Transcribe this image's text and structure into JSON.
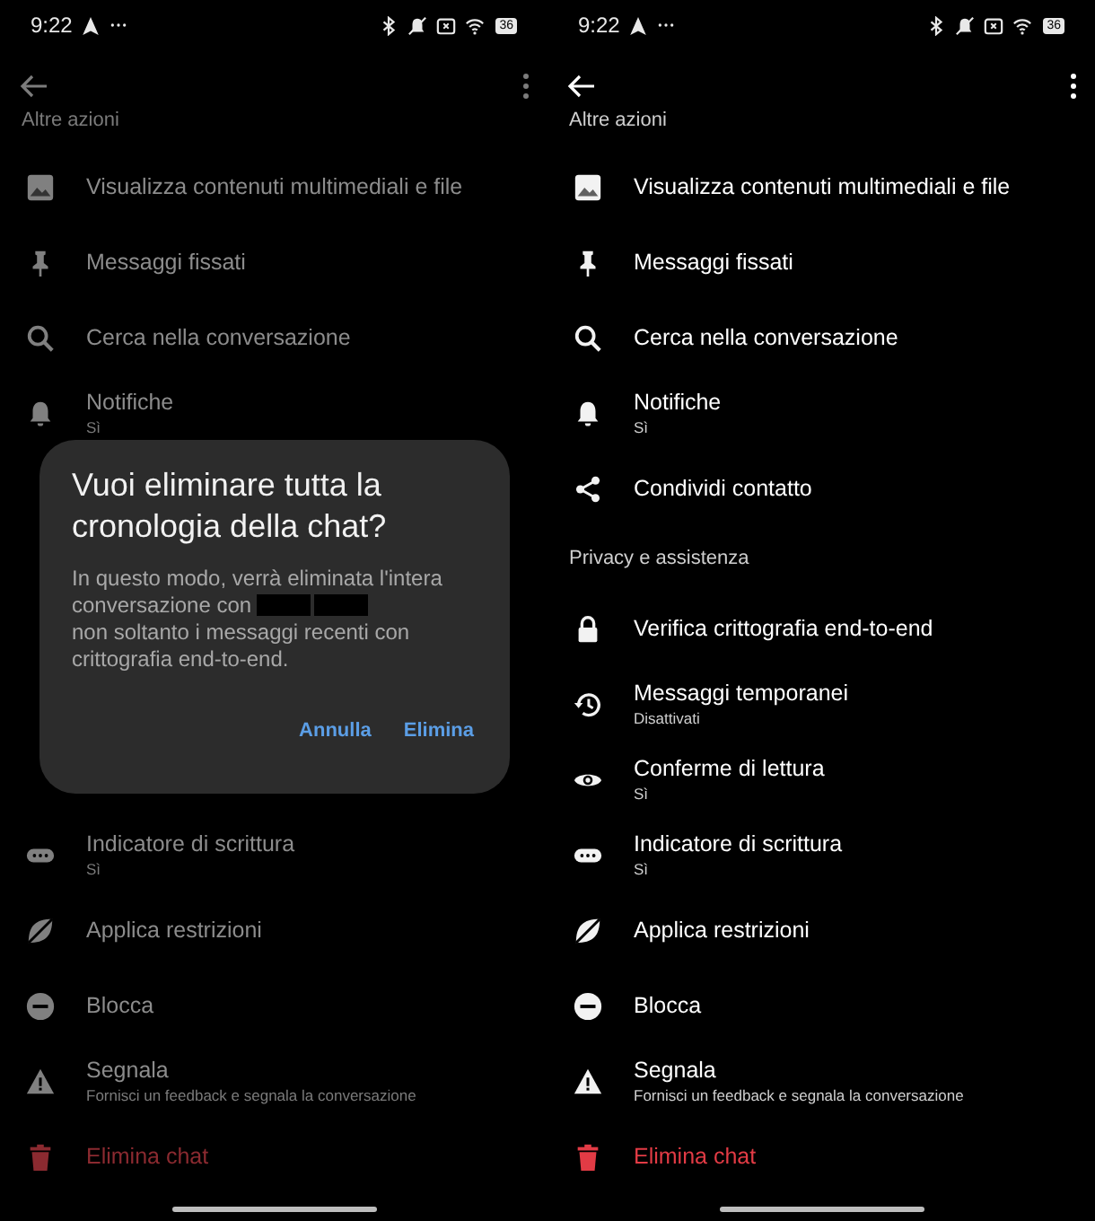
{
  "screens": [
    {
      "dimmed": true,
      "status_bar": {
        "time": "9:22",
        "battery": "36"
      },
      "rows": [
        {
          "kind": "header",
          "label": "Altre azioni"
        },
        {
          "kind": "media",
          "label": "Visualizza contenuti multimediali e file",
          "danger": false
        },
        {
          "kind": "pin",
          "label": "Messaggi fissati",
          "danger": false
        },
        {
          "kind": "search",
          "label": "Cerca nella conversazione",
          "danger": false
        },
        {
          "kind": "notifications",
          "label": "Notifiche",
          "sublabel": "Sì",
          "danger": false
        },
        {
          "kind": "dialog",
          "title": "Vuoi eliminare tutta la cronologia della chat?",
          "message_start": "In questo modo, verrà eliminata l'intera conversazione con",
          "message_end": "non soltanto i messaggi recenti con crittografia end-to-end.",
          "buttons": [
            "Annulla",
            "Elimina"
          ]
        },
        {
          "kind": "typing",
          "label": "Indicatore di scrittura",
          "sublabel": "Sì",
          "danger": false
        },
        {
          "kind": "restrict",
          "label": "Applica restrizioni",
          "danger": false
        },
        {
          "kind": "block",
          "label": "Blocca",
          "danger": false
        },
        {
          "kind": "report",
          "label": "Segnala",
          "sublabel": "Fornisci un feedback e segnala la conversazione",
          "danger": false
        },
        {
          "kind": "delete",
          "label": "Elimina chat",
          "danger": true
        }
      ]
    },
    {
      "dimmed": false,
      "status_bar": {
        "time": "9:22",
        "battery": "36"
      },
      "rows": [
        {
          "kind": "header",
          "label": "Altre azioni"
        },
        {
          "kind": "media",
          "label": "Visualizza contenuti multimediali e file",
          "danger": false
        },
        {
          "kind": "pin",
          "label": "Messaggi fissati",
          "danger": false
        },
        {
          "kind": "search",
          "label": "Cerca nella conversazione",
          "danger": false
        },
        {
          "kind": "notifications",
          "label": "Notifiche",
          "sublabel": "Sì",
          "danger": false
        },
        {
          "kind": "share",
          "label": "Condividi contatto",
          "danger": false
        },
        {
          "kind": "header",
          "label": "Privacy e assistenza"
        },
        {
          "kind": "encryption",
          "label": "Verifica crittografia end-to-end",
          "danger": false
        },
        {
          "kind": "disappearing",
          "label": "Messaggi temporanei",
          "sublabel": "Disattivati",
          "danger": false
        },
        {
          "kind": "read_receipts",
          "label": "Conferme di lettura",
          "sublabel": "Sì",
          "danger": false
        },
        {
          "kind": "typing",
          "label": "Indicatore di scrittura",
          "sublabel": "Sì",
          "danger": false
        },
        {
          "kind": "restrict",
          "label": "Applica restrizioni",
          "danger": false
        },
        {
          "kind": "block",
          "label": "Blocca",
          "danger": false
        },
        {
          "kind": "report",
          "label": "Segnala",
          "sublabel": "Fornisci un feedback e segnala la conversazione",
          "danger": false
        },
        {
          "kind": "delete",
          "label": "Elimina chat",
          "danger": true
        }
      ]
    }
  ]
}
